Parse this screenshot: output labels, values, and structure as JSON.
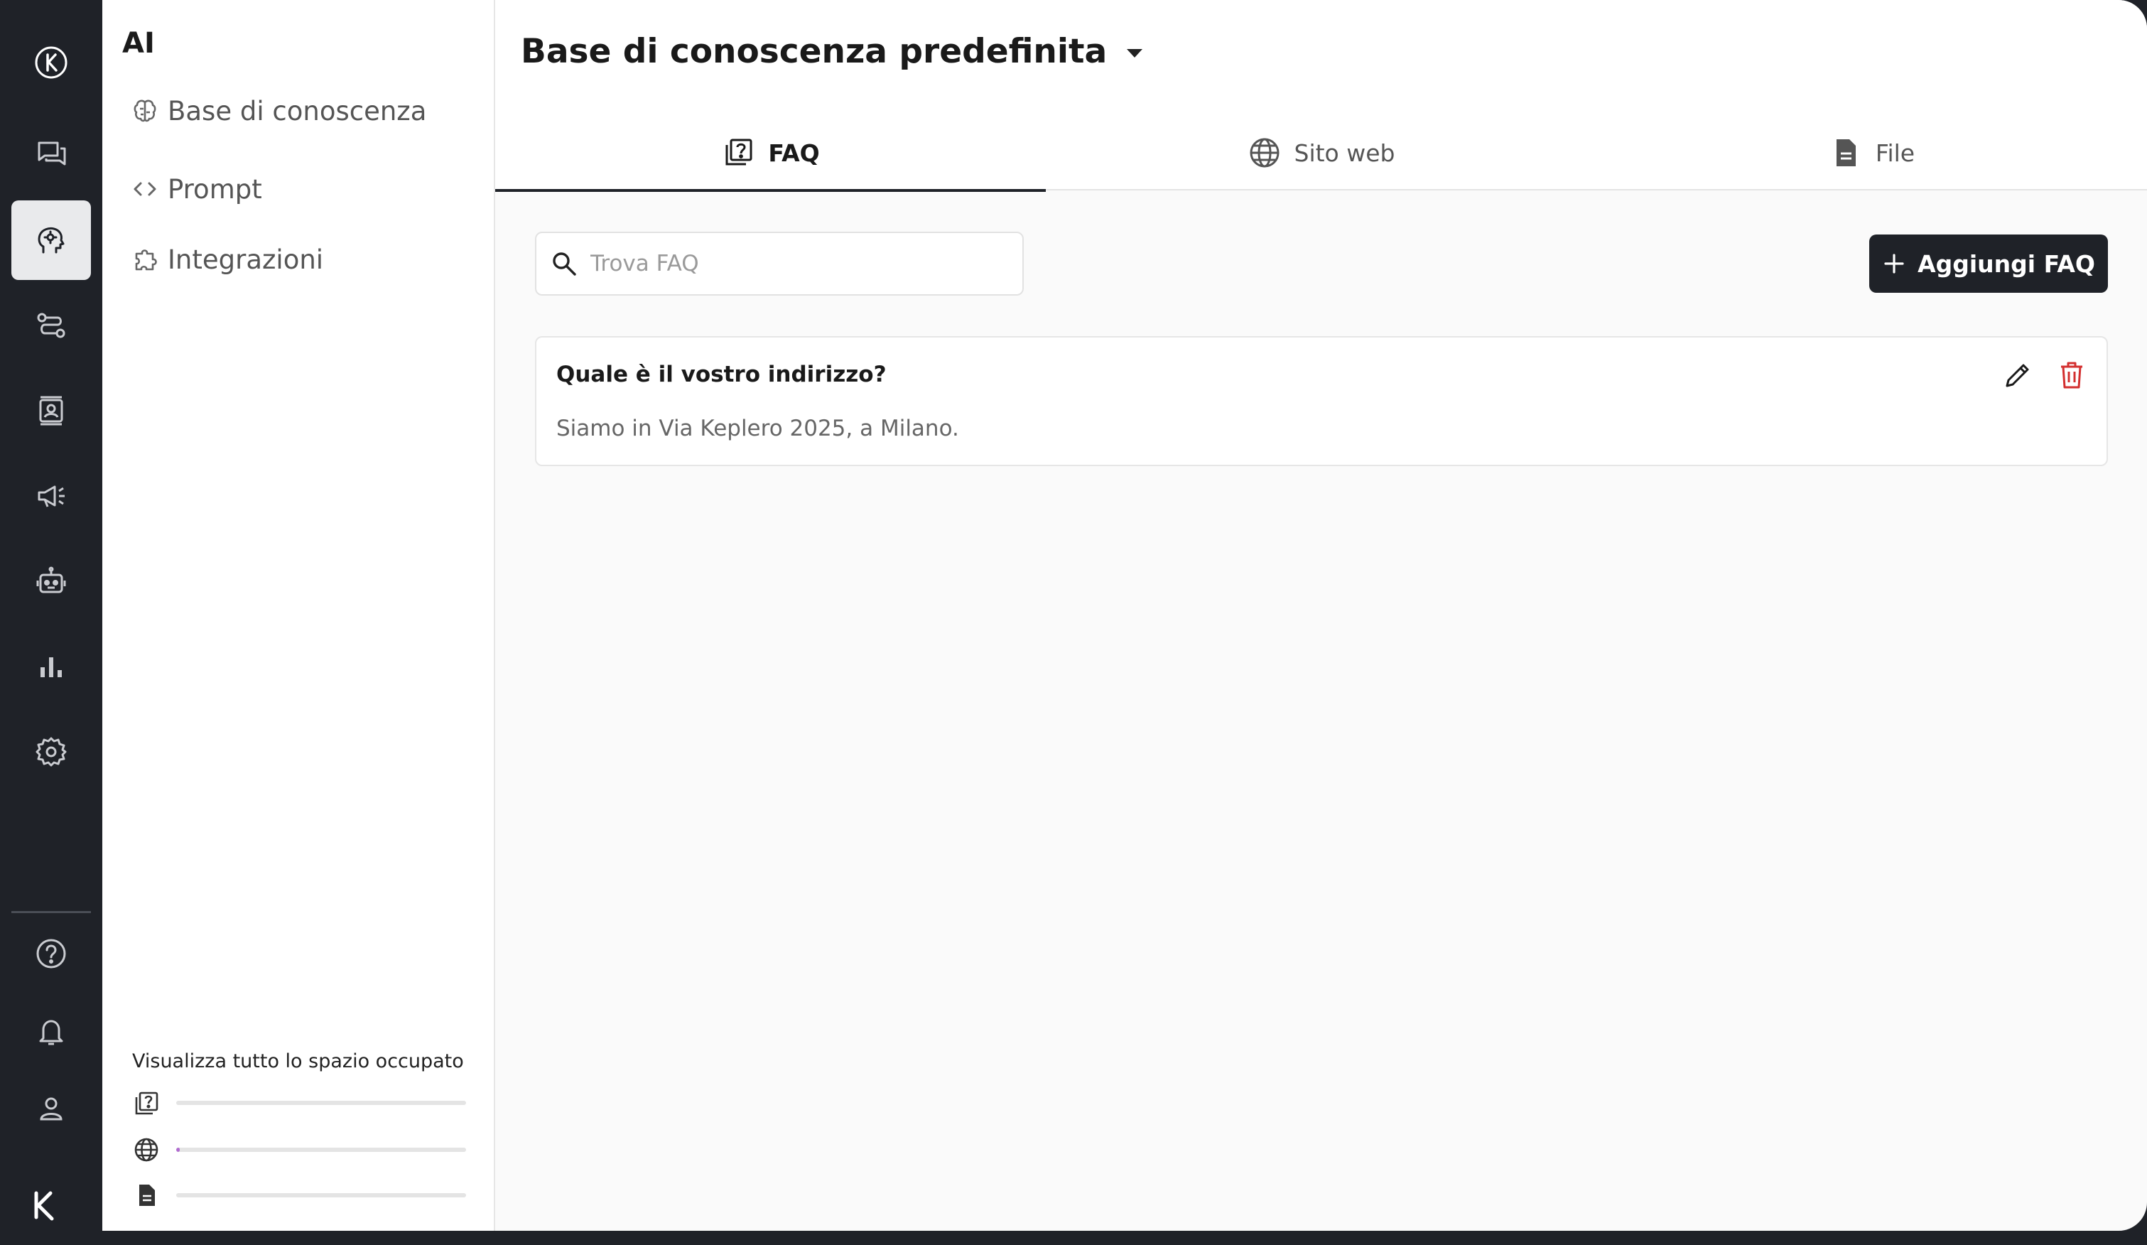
{
  "rail": {
    "items": [
      {
        "name": "chat-icon"
      },
      {
        "name": "ai-brain-icon",
        "active": true
      },
      {
        "name": "routes-icon"
      },
      {
        "name": "contacts-icon"
      },
      {
        "name": "megaphone-icon"
      },
      {
        "name": "robot-icon"
      },
      {
        "name": "analytics-icon"
      },
      {
        "name": "gear-icon"
      }
    ],
    "bottom": [
      {
        "name": "help-icon"
      },
      {
        "name": "bell-icon"
      },
      {
        "name": "user-icon"
      }
    ]
  },
  "sidebar": {
    "title": "AI",
    "items": [
      {
        "label": "Base di conoscenza",
        "icon": "brain-icon"
      },
      {
        "label": "Prompt",
        "icon": "code-icon"
      },
      {
        "label": "Integrazioni",
        "icon": "puzzle-icon"
      }
    ],
    "usage": {
      "title": "Visualizza tutto lo spazio occupato",
      "rows": [
        {
          "icon": "faq-icon",
          "fraction": 0.0
        },
        {
          "icon": "globe-icon",
          "fraction": 0.01
        },
        {
          "icon": "file-icon",
          "fraction": 0.0
        }
      ]
    }
  },
  "main": {
    "kb_title": "Base di conoscenza predefinita",
    "tabs": [
      {
        "label": "FAQ",
        "icon": "faq-icon",
        "active": true
      },
      {
        "label": "Sito web",
        "icon": "globe-icon"
      },
      {
        "label": "File",
        "icon": "file-icon"
      }
    ],
    "search": {
      "placeholder": "Trova FAQ",
      "value": ""
    },
    "add_button": "Aggiungi FAQ",
    "faqs": [
      {
        "question": "Quale è il vostro indirizzo?",
        "answer": "Siamo in Via Keplero 2025, a Milano."
      }
    ]
  },
  "colors": {
    "rail_bg": "#1f2228",
    "accent": "#1f2228",
    "danger": "#d32f2f",
    "usage_fill": "#b06ad0"
  }
}
